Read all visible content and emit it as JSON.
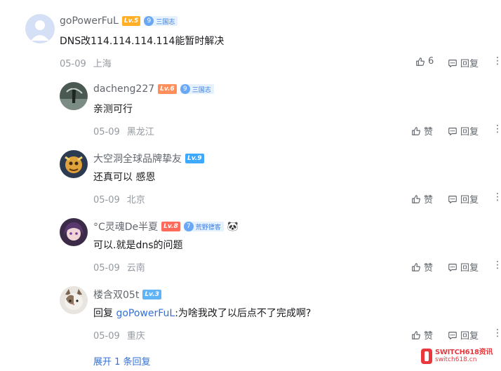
{
  "comments": [
    {
      "username": "goPowerFuL",
      "level": "Lv.5",
      "medal": {
        "num": "9",
        "label": "三国志"
      },
      "text": "DNS改114.114.114.114能暂时解决",
      "date": "05-09",
      "location": "上海",
      "like_label": "6",
      "reply_label": "回复",
      "more": "⋮"
    },
    {
      "username": "dacheng227",
      "level": "Lv.6",
      "medal": {
        "num": "9",
        "label": "三国志"
      },
      "text": "亲测可行",
      "date": "05-09",
      "location": "黑龙江",
      "like_label": "赞",
      "reply_label": "回复",
      "more": "⋮"
    },
    {
      "username": "大空洞全球品牌挚友",
      "level": "Lv.9",
      "text": "还真可以 感恩",
      "date": "05-09",
      "location": "北京",
      "like_label": "赞",
      "reply_label": "回复",
      "more": "⋮"
    },
    {
      "username": "°C灵魂De半夏",
      "level": "Lv.8",
      "medal": {
        "num": "7",
        "label": "荒野镖客"
      },
      "extra_badge": "🐼",
      "text": "可以.就是dns的问题",
      "date": "05-09",
      "location": "云南",
      "like_label": "赞",
      "reply_label": "回复",
      "more": "⋮"
    },
    {
      "username": "楼含双05t",
      "level": "Lv.3",
      "reply_prefix": "回复",
      "reply_to": "goPowerFuL",
      "text": ":为啥我改了以后点不了完成啊?",
      "date": "05-09",
      "location": "重庆",
      "like_label": "赞",
      "reply_label": "回复",
      "more": "⋮"
    }
  ],
  "expand_label": "展开 1 条回复",
  "watermark": {
    "line1": "SWITCH618资讯",
    "line2": "switch618.cn"
  },
  "colors": {
    "link": "#3370d6",
    "meta": "#9499a0",
    "text": "#18191c"
  }
}
